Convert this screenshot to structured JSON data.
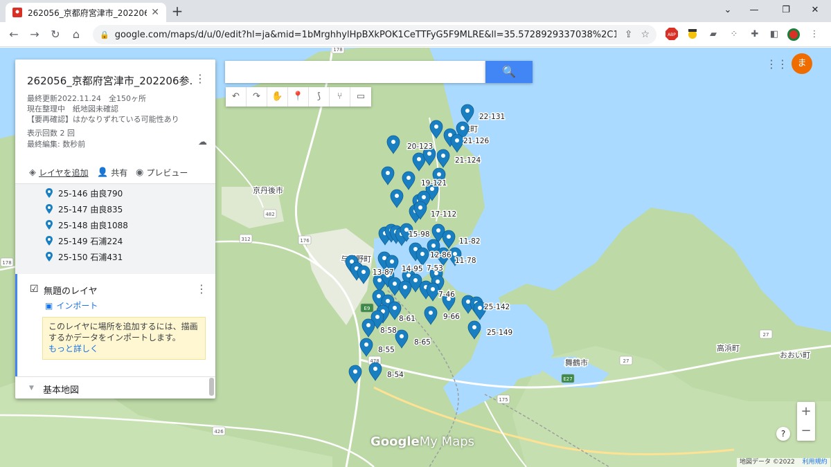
{
  "browser": {
    "tab_title": "262056_京都府宮津市_202206参",
    "new_tab": "+",
    "url": "google.com/maps/d/u/0/edit?hl=ja&mid=1bMrghhylHpBXkPOK1CeTTFyG5F9MLRE&ll=35.5728929337038%2C135.21491..."
  },
  "panel": {
    "title": "262056_京都府宮津市_202206参...",
    "updated": "最終更新2022.11.24　全150ヶ所",
    "status": "現在整理中　紙地図未確認",
    "note": "【要再確認】はかなりずれている可能性あり",
    "views": "表示回数 2 回",
    "last_edit": "最終編集: 数秒前",
    "actions": {
      "add_layer": "レイヤを追加",
      "share": "共有",
      "preview": "プレビュー"
    },
    "items": [
      "25-146 由良790",
      "25-147 由良835",
      "25-148 由良1088",
      "25-149 石浦224",
      "25-150 石浦431"
    ],
    "layer2": {
      "name": "無題のレイヤ",
      "import": "インポート",
      "tip": "このレイヤに場所を追加するには、描画するかデータをインポートします。",
      "more_link": "もっと詳しく"
    },
    "basemap": "基本地図"
  },
  "map": {
    "search_placeholder": "",
    "avatar_letter": "ま",
    "brand_google": "Google",
    "brand_mymaps": " My Maps",
    "attribution": "地図データ ©2022",
    "terms": "利用規約",
    "zoom_in": "+",
    "zoom_out": "−",
    "help": "?",
    "place_labels": [
      "京丹後市",
      "与謝野町",
      "舞鶴市",
      "高浜町",
      "おおい町",
      "浪町"
    ],
    "road_labels": [
      "178",
      "482",
      "312",
      "176",
      "E9",
      "478",
      "27",
      "175",
      "E27",
      "426",
      "178",
      "27"
    ],
    "marker_labels": [
      "22-131",
      "21-126",
      "20-123",
      "21-124",
      "19-121",
      "17-112",
      "15-98",
      "11-82",
      "12-86",
      "11-78",
      "14-95",
      "7-53",
      "13-87",
      "7-46",
      "8-61",
      "9-66",
      "25-142",
      "8-58",
      "25-149",
      "8-65",
      "8-55",
      "8-54"
    ],
    "colors": {
      "water": "#aadaff",
      "land": "#e3eecf",
      "forest": "#bcd9a6",
      "urban": "#ecebe4",
      "road": "#ffffff",
      "pin": "#1a7fc1",
      "accent": "#4285f4"
    }
  }
}
